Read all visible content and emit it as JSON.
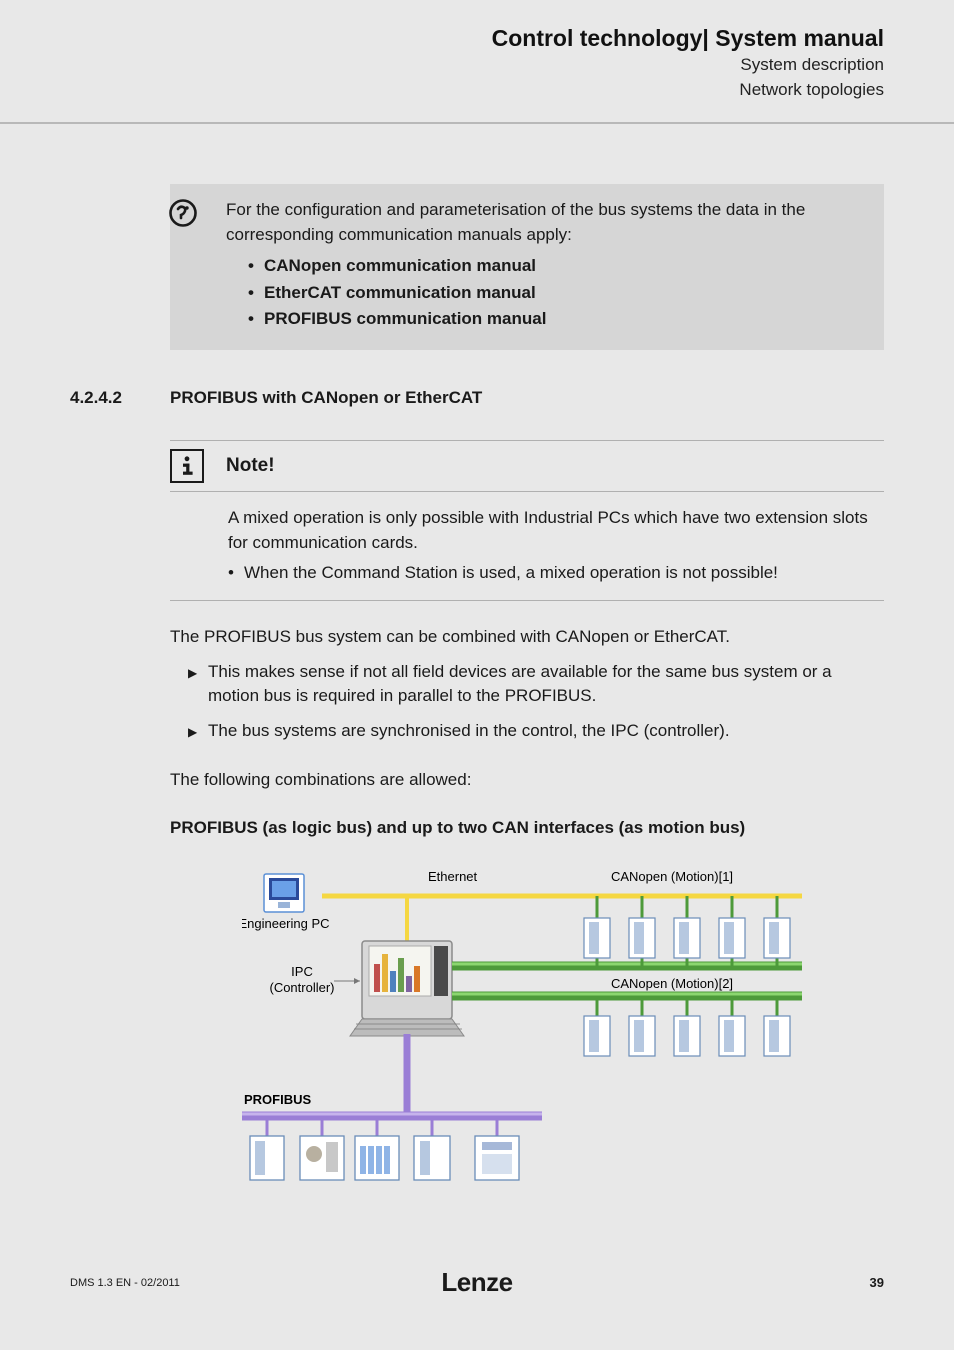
{
  "header": {
    "title": "Control technology| System manual",
    "sub1": "System description",
    "sub2": "Network topologies"
  },
  "tip": {
    "intro": "For the configuration and parameterisation of the bus systems the data in the corresponding communication manuals apply:",
    "items": [
      "CANopen communication manual",
      "EtherCAT communication manual",
      "PROFIBUS communication manual"
    ]
  },
  "section": {
    "number": "4.2.4.2",
    "title": "PROFIBUS with CANopen or EtherCAT"
  },
  "note": {
    "label": "Note!",
    "body": "A mixed operation is only possible with Industrial PCs which have two extension slots for communication cards.",
    "bullet": "When the Command Station is used, a mixed operation is not possible!"
  },
  "body": {
    "p1": "The PROFIBUS bus system can be combined with CANopen or EtherCAT.",
    "arrow1": "This makes sense if not all field devices are available for the same bus system or a motion bus is required in parallel to the PROFIBUS.",
    "arrow2": "The bus systems are synchronised in the control, the IPC (controller).",
    "p2": "The following combinations are allowed:",
    "subhead": "PROFIBUS (as logic bus) and up to two CAN interfaces (as motion bus)"
  },
  "diagram": {
    "ethernet": "Ethernet",
    "eng_pc": "Engineering PC",
    "ipc1": "IPC",
    "ipc2": "(Controller)",
    "can1": "CANopen (Motion)[1]",
    "can2": "CANopen (Motion)[2]",
    "profibus": "PROFIBUS"
  },
  "footer": {
    "left": "DMS 1.3 EN - 02/2011",
    "brand": "Lenze",
    "page": "39"
  }
}
